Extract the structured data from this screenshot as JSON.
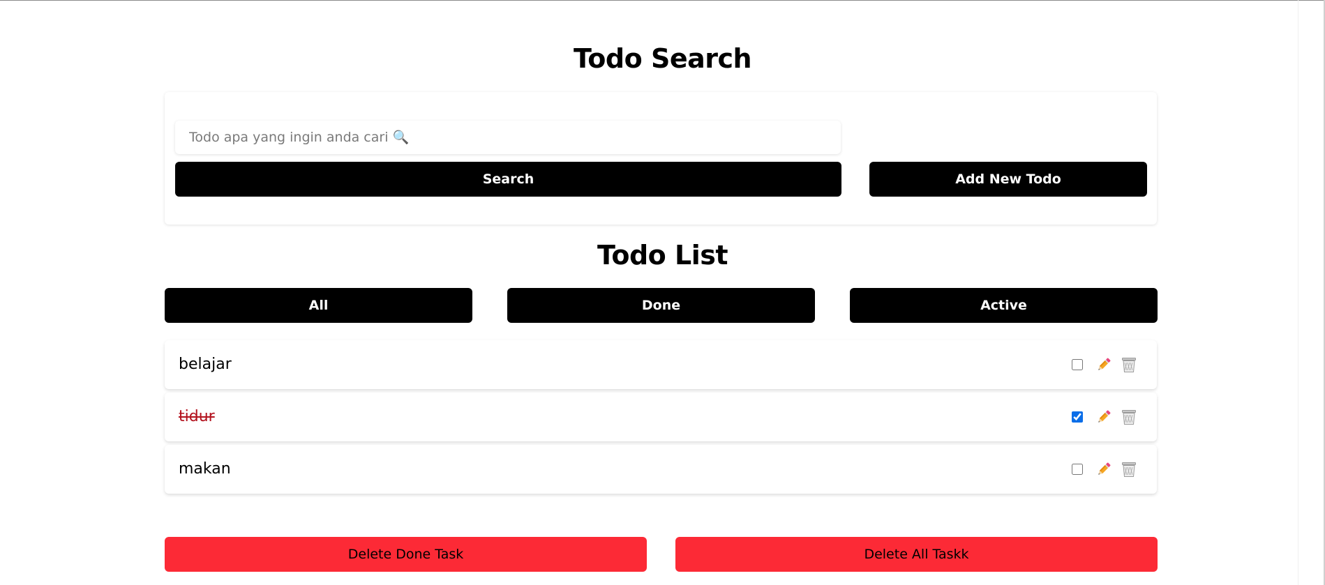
{
  "search_section": {
    "title": "Todo Search",
    "search_placeholder": "Todo apa yang ingin anda cari 🔍",
    "search_button": "Search",
    "add_button": "Add New Todo"
  },
  "list_section": {
    "title": "Todo List",
    "filters": [
      "All",
      "Done",
      "Active"
    ]
  },
  "todos": [
    {
      "text": "belajar",
      "done": false
    },
    {
      "text": "tidur",
      "done": true
    },
    {
      "text": "makan",
      "done": false
    }
  ],
  "actions": {
    "delete_done": "Delete Done Task",
    "delete_all": "Delete All Taskk"
  },
  "icons": {
    "edit": "pencil-icon",
    "delete": "trash-icon"
  },
  "colors": {
    "primary_button": "#000000",
    "danger_button": "#fc2a36",
    "done_text": "#b3121e",
    "checkbox_accent": "#0b6ee8"
  }
}
